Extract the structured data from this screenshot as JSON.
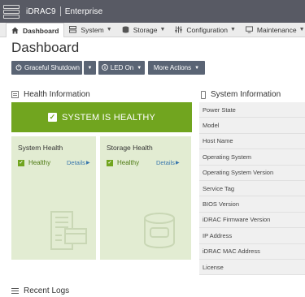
{
  "header": {
    "product": "iDRAC9",
    "edition": "Enterprise"
  },
  "nav": {
    "tabs": [
      {
        "label": "Dashboard",
        "icon": "home-icon",
        "active": true
      },
      {
        "label": "System",
        "icon": "server-icon"
      },
      {
        "label": "Storage",
        "icon": "database-icon"
      },
      {
        "label": "Configuration",
        "icon": "sliders-icon"
      },
      {
        "label": "Maintenance",
        "icon": "monitor-icon"
      }
    ]
  },
  "page": {
    "title": "Dashboard"
  },
  "actions": {
    "shutdown_label": "Graceful Shutdown",
    "led_label": "LED On",
    "more_label": "More Actions"
  },
  "health": {
    "title": "Health Information",
    "banner": "SYSTEM IS HEALTHY",
    "banner_color": "#71a51f",
    "panels": [
      {
        "title": "System Health",
        "status": "Healthy",
        "details": "Details"
      },
      {
        "title": "Storage Health",
        "status": "Healthy",
        "details": "Details"
      }
    ]
  },
  "system_info": {
    "title": "System Information",
    "fields": [
      "Power State",
      "Model",
      "Host Name",
      "Operating System",
      "Operating System Version",
      "Service Tag",
      "BIOS Version",
      "iDRAC Firmware Version",
      "IP Address",
      "iDRAC MAC Address",
      "License"
    ]
  },
  "logs": {
    "title": "Recent Logs"
  }
}
